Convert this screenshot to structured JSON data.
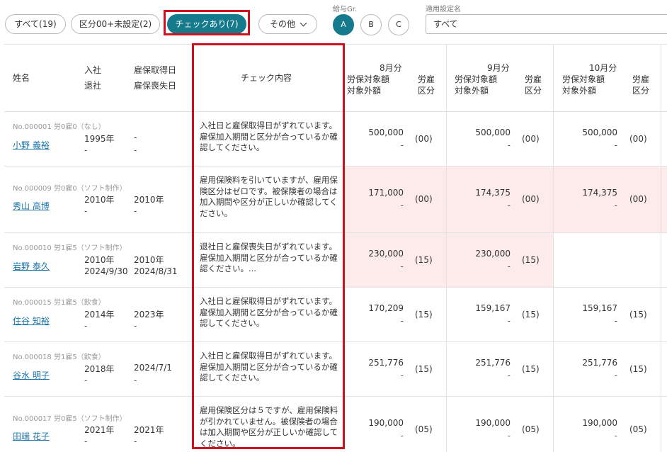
{
  "filters": {
    "all_label": "すべて(19)",
    "unset_label": "区分00+未設定(2)",
    "check_label": "チェックあり(7)",
    "other_label": "その他",
    "salary_group_label": "給与Gr.",
    "groups": [
      "A",
      "B",
      "C"
    ],
    "setting_label": "適用設定名",
    "setting_value": "すべて"
  },
  "headers": {
    "name": "姓名",
    "joined": "入社",
    "left": "退社",
    "ins_acquired": "雇保取得日",
    "ins_lost": "雇保喪失日",
    "check_content": "チェック内容",
    "months": [
      {
        "label": "8月分",
        "sub1": "労保対象額",
        "sub2": "対象外額",
        "cls1": "労雇",
        "cls2": "区分"
      },
      {
        "label": "9月分",
        "sub1": "労保対象額",
        "sub2": "対象外額",
        "cls1": "労雇",
        "cls2": "区分"
      },
      {
        "label": "10月分",
        "sub1": "労保対象額",
        "sub2": "対象外額",
        "cls1": "労雇",
        "cls2": "区分"
      }
    ]
  },
  "rows": [
    {
      "meta": "No.000001 労0雇0（なし）",
      "name": "小野 義裕",
      "joined": "1995年",
      "left": "-",
      "acq": "-",
      "lost": "-",
      "check": "入社日と雇保取得日がずれています。雇保加入期間と区分が合っているか確認してください。",
      "m8": "500,000",
      "m8b": "-",
      "c8": "(00)",
      "m9": "500,000",
      "m9b": "-",
      "c9": "(00)",
      "m10": "500,000",
      "m10b": "-",
      "c10": "(00)"
    },
    {
      "meta": "No.000009 労0雇0（ソフト制作）",
      "name": "秀山 高博",
      "joined": "2010年",
      "left": "-",
      "acq": "2010年",
      "lost": "-",
      "check": "雇用保険料を引いていますが、雇用保険区分はゼロです。被保険者の場合は加入期間や区分が正しいか確認してください。",
      "m8": "171,000",
      "m8b": "-",
      "c8": "(00)",
      "m9": "174,375",
      "m9b": "-",
      "c9": "(00)",
      "m10": "174,375",
      "m10b": "-",
      "c10": "(00)"
    },
    {
      "meta": "No.000010 労1雇5（ソフト制作）",
      "name": "岩野 泰久",
      "joined": "2010年",
      "left": "2024/9/30",
      "acq": "2010年",
      "lost": "2024/8/31",
      "check": "退社日と雇保喪失日がずれています。雇保加入期間と区分が合っているか確認ください。...",
      "m8": "230,000",
      "m8b": "-",
      "c8": "(15)",
      "m9": "230,000",
      "m9b": "-",
      "c9": "(15)",
      "m10": "",
      "m10b": "",
      "c10": ""
    },
    {
      "meta": "No.000015 労1雇5（飲食）",
      "name": "住谷 知裕",
      "joined": "2014年",
      "left": "-",
      "acq": "2023年",
      "lost": "-",
      "check": "入社日と雇保取得日がずれています。雇保加入期間と区分が合っているか確認してください。",
      "m8": "170,209",
      "m8b": "-",
      "c8": "(15)",
      "m9": "159,167",
      "m9b": "-",
      "c9": "(15)",
      "m10": "159,167",
      "m10b": "-",
      "c10": "(15)"
    },
    {
      "meta": "No.000018 労1雇5（飲食）",
      "name": "谷水 明子",
      "joined": "2018年",
      "left": "-",
      "acq": "2024/7/1",
      "lost": "-",
      "check": "入社日と雇保取得日がずれています。雇保加入期間と区分が合っているか確認してください。",
      "m8": "251,776",
      "m8b": "-",
      "c8": "(15)",
      "m9": "251,776",
      "m9b": "-",
      "c9": "(15)",
      "m10": "251,776",
      "m10b": "-",
      "c10": "(15)"
    },
    {
      "meta": "No.000017 労0雇5（ソフト制作）",
      "name": "田端 花子",
      "joined": "2021年",
      "left": "-",
      "acq": "2021年",
      "lost": "-",
      "check": "雇用保険区分は５ですが、雇用保険料が引かれていません。被保険者の場合は加入期間や区分が正しいか確認してください。",
      "m8": "190,000",
      "m8b": "-",
      "c8": "(05)",
      "m9": "190,000",
      "m9b": "-",
      "c9": "(05)",
      "m10": "190,000",
      "m10b": "-",
      "c10": "(05)"
    }
  ],
  "highlight_color": "#fdeaea",
  "accent_color": "#157a8c",
  "alert_color": "#d0111b"
}
